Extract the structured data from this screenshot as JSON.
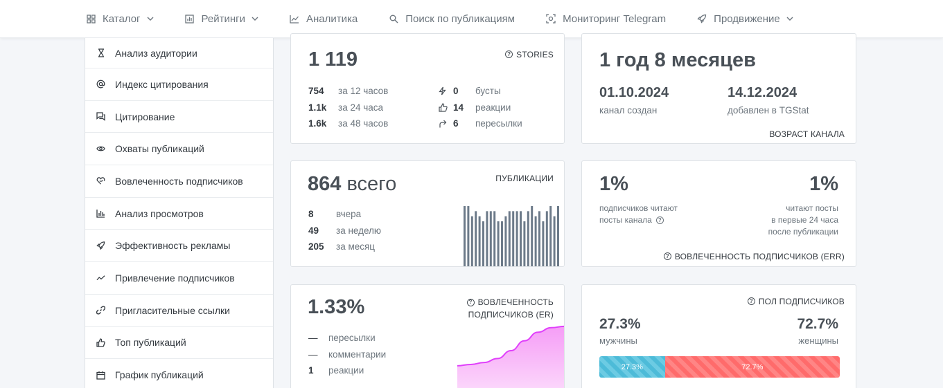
{
  "nav": {
    "items": [
      {
        "label": "Каталог",
        "icon": "grid-icon",
        "dropdown": true
      },
      {
        "label": "Рейтинги",
        "icon": "bar-chart-icon",
        "dropdown": true
      },
      {
        "label": "Аналитика",
        "icon": "line-chart-icon",
        "dropdown": false
      },
      {
        "label": "Поиск по публикациям",
        "icon": "search-icon",
        "dropdown": false
      },
      {
        "label": "Мониторинг Telegram",
        "icon": "monitor-icon",
        "dropdown": false
      },
      {
        "label": "Продвижение",
        "icon": "rocket-icon",
        "dropdown": true
      }
    ]
  },
  "sidebar": {
    "items": [
      {
        "label": "Анализ аудитории",
        "icon": "hourglass-icon"
      },
      {
        "label": "Индекс цитирования",
        "icon": "at-icon"
      },
      {
        "label": "Цитирование",
        "icon": "quote-icon"
      },
      {
        "label": "Охваты публикаций",
        "icon": "eye-icon"
      },
      {
        "label": "Вовлеченность подписчиков",
        "icon": "engagement-icon"
      },
      {
        "label": "Анализ просмотров",
        "icon": "bar-chart-icon"
      },
      {
        "label": "Эффективность рекламы",
        "icon": "rocket-icon"
      },
      {
        "label": "Привлечение подписчиков",
        "icon": "trend-icon"
      },
      {
        "label": "Пригласительные ссылки",
        "icon": "link-icon"
      },
      {
        "label": "Топ публикаций",
        "icon": "thumbs-up-icon"
      },
      {
        "label": "График публикаций",
        "icon": "calendar-icon"
      }
    ]
  },
  "stories": {
    "total": "1 119",
    "caption": "STORIES",
    "rows": [
      {
        "num": "754",
        "label": "за 12 часов"
      },
      {
        "num": "1.1k",
        "label": "за 24 часа"
      },
      {
        "num": "1.6k",
        "label": "за 48 часов"
      }
    ],
    "side_rows": [
      {
        "icon": "bolt-icon",
        "num": "0",
        "label": "бусты"
      },
      {
        "icon": "thumbs-up-icon",
        "num": "14",
        "label": "реакции"
      },
      {
        "icon": "share-icon",
        "num": "6",
        "label": "пересылки"
      }
    ]
  },
  "age": {
    "value": "1 год 8 месяцев",
    "created_date": "01.10.2024",
    "created_label": "канал создан",
    "added_date": "14.12.2024",
    "added_label": "добавлен в TGStat",
    "caption": "ВОЗРАСТ КАНАЛА"
  },
  "posts": {
    "total": "864",
    "total_suffix": "всего",
    "caption": "ПУБЛИКАЦИИ",
    "rows": [
      {
        "num": "8",
        "label": "вчера"
      },
      {
        "num": "49",
        "label": "за неделю"
      },
      {
        "num": "205",
        "label": "за месяц"
      }
    ],
    "bar_color": "#6c7a89"
  },
  "err": {
    "left_value": "1%",
    "left_label_1": "подписчиков читают",
    "left_label_2": "посты канала",
    "right_value": "1%",
    "right_label_1": "читают посты",
    "right_label_2": "в первые 24 часа",
    "right_label_3": "после публикации",
    "caption": "ВОВЛЕЧЕННОСТЬ ПОДПИСЧИКОВ (ERR)"
  },
  "er": {
    "value": "1.33%",
    "caption_1": "ВОВЛЕЧЕННОСТЬ",
    "caption_2": "ПОДПИСЧИКОВ (ER)",
    "rows": [
      {
        "num": "—",
        "label": "пересылки"
      },
      {
        "num": "—",
        "label": "комментарии"
      },
      {
        "num": "1",
        "label": "реакции"
      }
    ],
    "line_color": "#e040fb"
  },
  "gender": {
    "caption": "ПОЛ ПОДПИСЧИКОВ",
    "male_value": "27.3%",
    "male_label": "мужчины",
    "female_value": "72.7%",
    "female_label": "женщины",
    "male_pct": 27.3,
    "female_pct": 72.7,
    "male_bar_label": "27.3%",
    "female_bar_label": "72.7%",
    "male_color": "#4dbbd8",
    "female_color": "#ff6b6b"
  },
  "chart_data": [
    {
      "type": "bar",
      "values": [
        12,
        12,
        10,
        11,
        10,
        9,
        11,
        11,
        11,
        9,
        9,
        10,
        11,
        11,
        11,
        11,
        9,
        11,
        12,
        10,
        11,
        9,
        11,
        12,
        10,
        12
      ]
    },
    {
      "type": "area",
      "values": [
        0.37,
        0.39,
        0.42,
        0.48,
        0.6,
        0.75,
        0.88,
        0.95,
        0.97
      ]
    }
  ]
}
